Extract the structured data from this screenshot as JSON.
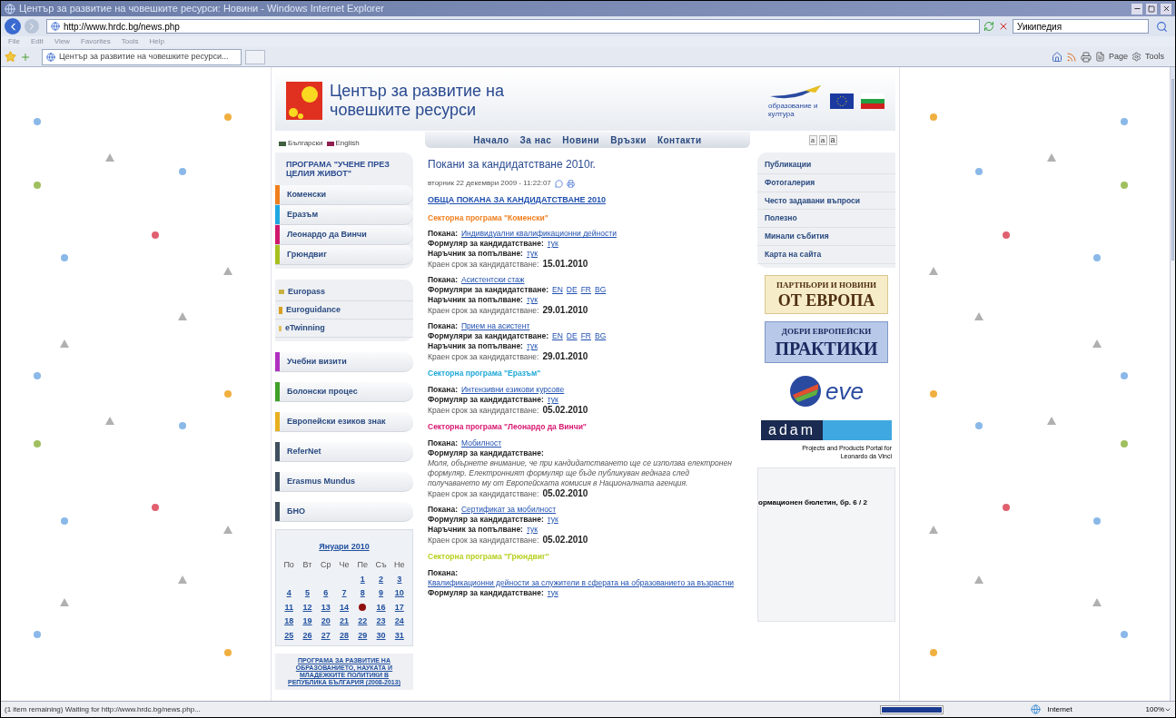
{
  "window": {
    "title": "Център за развитие на човешките ресурси: Новини - Windows Internet Explorer"
  },
  "address_bar": {
    "url": "http://www.hrdc.bg/news.php",
    "search_value": "Уикипедия"
  },
  "menu_bar": [
    "File",
    "Edit",
    "View",
    "Favorites",
    "Tools",
    "Help"
  ],
  "tab": {
    "title": "Център за развитие на човешките ресурси..."
  },
  "command_bar": [
    "Page",
    "Tools"
  ],
  "site": {
    "title_line_1": "Център за развитие на",
    "title_line_2": "човешките ресурси",
    "partner_caption": "образование и култура",
    "nav": [
      "Начало",
      "За нас",
      "Новини",
      "Връзки",
      "Контакти"
    ],
    "font_sizes": [
      "a",
      "a",
      "a"
    ],
    "languages": [
      "Български",
      "English"
    ],
    "programme_group": {
      "heading": "ПРОГРАМА \"УЧЕНЕ ПРЕЗ ЦЕЛИЯ ЖИВОТ\"",
      "items": [
        {
          "label": "Коменски",
          "color": "#f07f1e"
        },
        {
          "label": "Еразъм",
          "color": "#20a8e0"
        },
        {
          "label": "Леонардо да Винчи",
          "color": "#d0186c"
        },
        {
          "label": "Грюндвиг",
          "color": "#a8c020"
        }
      ]
    },
    "tools_group": [
      "Europass",
      "Euroguidance",
      "eTwinning"
    ],
    "single_items": [
      {
        "label": "Учебни визити",
        "color": "#b030c0"
      },
      {
        "label": "Болонски процес",
        "color": "#40a028"
      },
      {
        "label": "Европейски езиков знак",
        "color": "#e8b020"
      },
      {
        "label": "ReferNet",
        "color": "#405060"
      },
      {
        "label": "Erasmus Mundus",
        "color": "#405060"
      },
      {
        "label": "БНО",
        "color": "#405060"
      }
    ],
    "calendar": {
      "month": "Януари 2010",
      "weekdays": [
        "По",
        "Вт",
        "Ср",
        "Че",
        "Пе",
        "Съ",
        "Не"
      ],
      "weeks": [
        [
          {
            "kind": "day",
            "day": "1"
          },
          {
            "kind": "day",
            "day": "2"
          },
          {
            "kind": "day",
            "day": "3"
          }
        ],
        [
          {
            "kind": "day",
            "day": "4"
          },
          {
            "kind": "day",
            "day": "5"
          },
          {
            "kind": "day",
            "day": "6"
          },
          {
            "kind": "day",
            "day": "7"
          },
          {
            "kind": "day",
            "day": "8"
          },
          {
            "kind": "day",
            "day": "9"
          },
          {
            "kind": "day",
            "day": "10"
          }
        ],
        [
          {
            "kind": "day",
            "day": "11"
          },
          {
            "kind": "day",
            "day": "12"
          },
          {
            "kind": "day",
            "day": "13"
          },
          {
            "kind": "day",
            "day": "14"
          },
          {
            "kind": "dot"
          },
          {
            "kind": "day",
            "day": "16"
          },
          {
            "kind": "day",
            "day": "17"
          }
        ],
        [
          {
            "kind": "day",
            "day": "18"
          },
          {
            "kind": "day",
            "day": "19"
          },
          {
            "kind": "day",
            "day": "20"
          },
          {
            "kind": "day",
            "day": "21"
          },
          {
            "kind": "day",
            "day": "22"
          },
          {
            "kind": "day",
            "day": "23"
          },
          {
            "kind": "day",
            "day": "24"
          }
        ],
        [
          {
            "kind": "day",
            "day": "25"
          },
          {
            "kind": "day",
            "day": "26"
          },
          {
            "kind": "day",
            "day": "27"
          },
          {
            "kind": "day",
            "day": "28"
          },
          {
            "kind": "day",
            "day": "29"
          },
          {
            "kind": "day",
            "day": "30"
          },
          {
            "kind": "day",
            "day": "31"
          }
        ]
      ]
    },
    "programme_link": "ПРОГРАМА ЗА РАЗВИТИЕ НА ОБРАЗОВАНИЕТО, НАУКАТА И МЛАДЕЖКИТЕ ПОЛИТИКИ В РЕПУБЛИКА БЪЛГАРИЯ (2008-2013)",
    "article": {
      "title": "Покани за кандидатстване 2010г.",
      "date": "вторник 22 декември 2009 - 11:22:07",
      "main_link": "ОБЩА ПОКАНА ЗА КАНДИДАТСТВАНЕ 2010",
      "sections": [
        {
          "heading": "Секторна програма \"Коменски\"",
          "color": "#f08020",
          "calls": [
            {
              "lines": [
                {
                  "kind": "links",
                  "label": "Покана:",
                  "links": [
                    "Индивидуални квалификационни дейности"
                  ]
                },
                {
                  "kind": "links",
                  "label": "Формуляр за кандидатстване:",
                  "links": [
                    "тук"
                  ]
                },
                {
                  "kind": "links",
                  "label": "Наръчник за попълване:",
                  "links": [
                    "тук"
                  ]
                },
                {
                  "kind": "deadline",
                  "label": "Краен срок за кандидатстване:",
                  "value": "15.01.2010"
                }
              ]
            },
            {
              "lines": [
                {
                  "kind": "links",
                  "label": "Покана:",
                  "links": [
                    "Асистентски стаж"
                  ]
                },
                {
                  "kind": "links",
                  "label": "Формуляри за кандидатстване:",
                  "links": [
                    "EN",
                    "DE",
                    "FR",
                    "BG"
                  ]
                },
                {
                  "kind": "links",
                  "label": "Наръчник за попълване:",
                  "links": [
                    "тук"
                  ]
                },
                {
                  "kind": "deadline",
                  "label": "Краен срок за кандидатстване:",
                  "value": "29.01.2010"
                }
              ]
            },
            {
              "lines": [
                {
                  "kind": "links",
                  "label": "Покана:",
                  "links": [
                    "Прием на асистент"
                  ]
                },
                {
                  "kind": "links",
                  "label": "Формуляри за кандидатстване:",
                  "links": [
                    "EN",
                    "DE",
                    "FR",
                    "BG"
                  ]
                },
                {
                  "kind": "links",
                  "label": "Наръчник за попълване:",
                  "links": [
                    "тук"
                  ]
                },
                {
                  "kind": "deadline",
                  "label": "Краен срок за кандидатстване:",
                  "value": "29.01.2010"
                }
              ]
            }
          ]
        },
        {
          "heading": "Секторна програма \"Еразъм\"",
          "color": "#20a8d8",
          "calls": [
            {
              "lines": [
                {
                  "kind": "links",
                  "label": "Покана:",
                  "links": [
                    "Интензивни езикови курсове"
                  ]
                },
                {
                  "kind": "links",
                  "label": "Формуляр за кандидатстване:",
                  "links": [
                    "тук"
                  ]
                },
                {
                  "kind": "deadline",
                  "label": "Краен срок за кандидатстване:",
                  "value": "05.02.2010"
                }
              ]
            }
          ]
        },
        {
          "heading": "Секторна програма \"Леонардо да Винчи\"",
          "color": "#d81870",
          "calls": [
            {
              "lines": [
                {
                  "kind": "links",
                  "label": "Покана:",
                  "links": [
                    "Мобилност"
                  ]
                },
                {
                  "kind": "note",
                  "label": "Формуляр за кандидатстване:",
                  "text": "Моля, обърнете внимание, че при кандидатстването ще се използва електронен формуляр. Електронният формуляр ще бъде публикуван веднага след получаването му от Европейската комисия в Националната агенция."
                },
                {
                  "kind": "deadline",
                  "label": "Краен срок за кандидатстване:",
                  "value": "05.02.2010"
                }
              ]
            },
            {
              "lines": [
                {
                  "kind": "links",
                  "label": "Покана:",
                  "links": [
                    "Сертификат за мобилност"
                  ]
                },
                {
                  "kind": "links",
                  "label": "Формуляр за кандидатстване:",
                  "links": [
                    "тук"
                  ]
                },
                {
                  "kind": "links",
                  "label": "Наръчник за попълване:",
                  "links": [
                    "тук"
                  ]
                },
                {
                  "kind": "deadline",
                  "label": "Краен срок за кандидатстване:",
                  "value": "05.02.2010"
                }
              ]
            }
          ]
        },
        {
          "heading": "Секторна програма \"Грюндвиг\"",
          "color": "#b8d020",
          "calls": [
            {
              "lines": [
                {
                  "kind": "links",
                  "label": "Покана:",
                  "links": [
                    "Квалификационни дейности за служители в сферата на образованието за възрастни"
                  ]
                },
                {
                  "kind": "links",
                  "label": "Формуляр за кандидатстване:",
                  "links": [
                    "тук"
                  ]
                }
              ]
            }
          ]
        }
      ]
    },
    "right_menu": [
      "Публикации",
      "Фотогалерия",
      "Често задавани въпроси",
      "Полезно",
      "Минали събития",
      "Карта на сайта"
    ],
    "banners": [
      {
        "kind": "partners",
        "line_1": "ПАРТНЬОРИ И НОВИНИ",
        "line_2": "ОТ ЕВРОПА"
      },
      {
        "kind": "practices",
        "line_1": "ДОБРИ ЕВРОПЕЙСКИ",
        "line_2": "ПРАКТИКИ"
      },
      {
        "kind": "eve",
        "line_1": "eve"
      },
      {
        "kind": "adam",
        "line_1": "adam",
        "line_2": "Projects and Products Portal for Leonardo da Vinci"
      }
    ],
    "bulletin": {
      "title": "ормационен бюлетин, бр. 6 / 2"
    }
  },
  "status_bar": {
    "text": "(1 item remaining) Waiting for http://www.hrdc.bg/news.php...",
    "progress": {
      "level": 1
    },
    "zone": "Internet",
    "zoom": "100%"
  }
}
